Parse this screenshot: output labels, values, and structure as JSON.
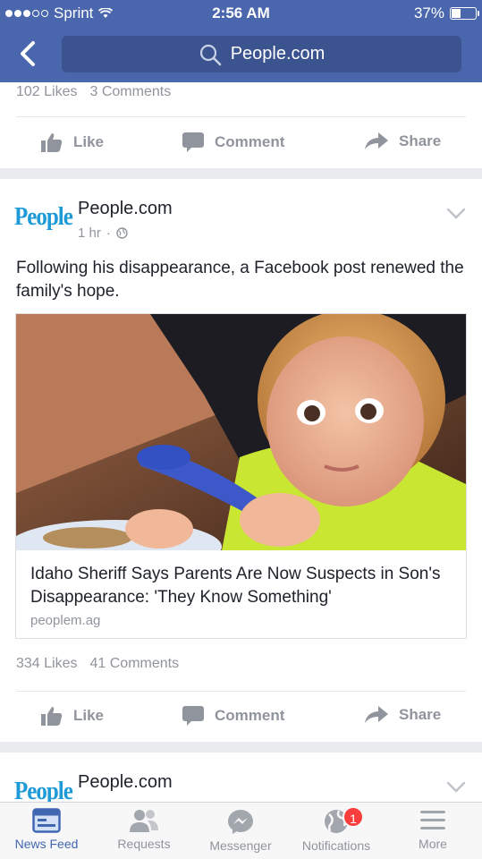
{
  "status_bar": {
    "carrier": "Sprint",
    "time": "2:56 AM",
    "battery": "37%"
  },
  "nav": {
    "search_text": "People.com"
  },
  "prev_post": {
    "likes": "102 Likes",
    "comments": "3 Comments",
    "actions": {
      "like": "Like",
      "comment": "Comment",
      "share": "Share"
    }
  },
  "post": {
    "page_logo": "People",
    "page_name": "People.com",
    "time": "1 hr",
    "text": "Following his disappearance, a Facebook post renewed the family's hope.",
    "link": {
      "title": "Idaho Sheriff Says Parents Are Now Suspects in Son's Disappearance: 'They Know Something'",
      "domain": "peoplem.ag"
    },
    "likes": "334 Likes",
    "comments": "41 Comments",
    "actions": {
      "like": "Like",
      "comment": "Comment",
      "share": "Share"
    }
  },
  "next_post": {
    "page_logo": "People",
    "page_name": "People.com"
  },
  "tabs": [
    {
      "label": "News Feed",
      "icon": "news-feed-icon",
      "active": true
    },
    {
      "label": "Requests",
      "icon": "friends-icon"
    },
    {
      "label": "Messenger",
      "icon": "messenger-icon"
    },
    {
      "label": "Notifications",
      "icon": "globe-icon",
      "badge": "1"
    },
    {
      "label": "More",
      "icon": "menu-icon"
    }
  ],
  "colors": {
    "header_blue": "#4a67ad",
    "accent_blue": "#4267b2",
    "badge_red": "#fa3e3e"
  }
}
